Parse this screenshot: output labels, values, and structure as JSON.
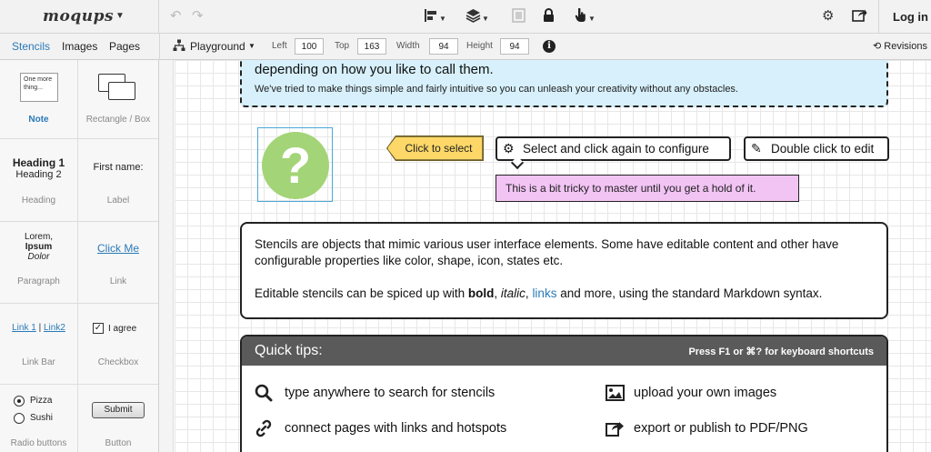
{
  "app": {
    "logo": "moqups"
  },
  "toolbar": {
    "login": "Log in",
    "undo_icon": "undo-icon",
    "redo_icon": "redo-icon",
    "align_icon": "align-icon",
    "layers_icon": "layers-icon",
    "group_icon": "group-icon",
    "lock_icon": "lock-icon",
    "interactions_icon": "hand-pointer-icon",
    "settings_icon": "gear-icon",
    "share_icon": "share-icon"
  },
  "library_tabs": [
    {
      "label": "Stencils",
      "active": true
    },
    {
      "label": "Images",
      "active": false
    },
    {
      "label": "Pages",
      "active": false
    }
  ],
  "page_selector": {
    "label": "Playground"
  },
  "props": {
    "left_label": "Left",
    "left_value": "100",
    "top_label": "Top",
    "top_value": "163",
    "width_label": "Width",
    "width_value": "94",
    "height_label": "Height",
    "height_value": "94"
  },
  "revisions": "Revisions",
  "stencils": {
    "note": {
      "preview": "One more thing...",
      "label": "Note"
    },
    "rectangle": {
      "label": "Rectangle / Box"
    },
    "heading": {
      "h1": "Heading 1",
      "h2": "Heading 2",
      "label": "Heading"
    },
    "label_stencil": {
      "preview": "First name:",
      "label": "Label"
    },
    "paragraph": {
      "line1": "Lorem,",
      "line2": "Ipsum",
      "line3": "Dolor",
      "label": "Paragraph"
    },
    "link": {
      "preview": "Click Me",
      "label": "Link"
    },
    "linkbar": {
      "link1": "Link 1",
      "sep": "|",
      "link2": "Link2",
      "label": "Link Bar"
    },
    "checkbox": {
      "preview": "I agree",
      "label": "Checkbox"
    },
    "radio": {
      "opt1": "Pizza",
      "opt2": "Sushi",
      "label": "Radio buttons"
    },
    "button": {
      "preview": "Submit",
      "label": "Button"
    }
  },
  "canvas": {
    "intro_title": "depending on how you like to call them.",
    "intro_text": "We've tried to make things simple and fairly intuitive so you can unleash your creativity without any obstacles.",
    "question_mark": "?",
    "click_select": "Click to select",
    "select_config": "Select and click again to configure",
    "double_click": "Double click to edit",
    "tricky": "This is a bit tricky to master until you get a hold of it.",
    "stencils_p1": "Stencils are objects that mimic various user interface elements. Some have editable content and other have configurable properties like color, shape, icon, states etc.",
    "stencils_p2_a": "Editable stencils can be spiced up with ",
    "stencils_p2_bold": "bold",
    "stencils_p2_b": ", ",
    "stencils_p2_italic": "italic",
    "stencils_p2_c": ", ",
    "stencils_p2_link": "links",
    "stencils_p2_d": " and more, using the standard Markdown syntax.",
    "tips_title": "Quick tips:",
    "tips_shortcut": "Press F1 or ⌘? for keyboard shortcuts",
    "tips": [
      {
        "icon": "search-icon",
        "text": "type anywhere to search for stencils"
      },
      {
        "icon": "image-icon",
        "text": "upload your own images"
      },
      {
        "icon": "link-icon",
        "text": "connect pages with links and hotspots"
      },
      {
        "icon": "export-icon",
        "text": "export or publish to PDF/PNG"
      }
    ]
  }
}
